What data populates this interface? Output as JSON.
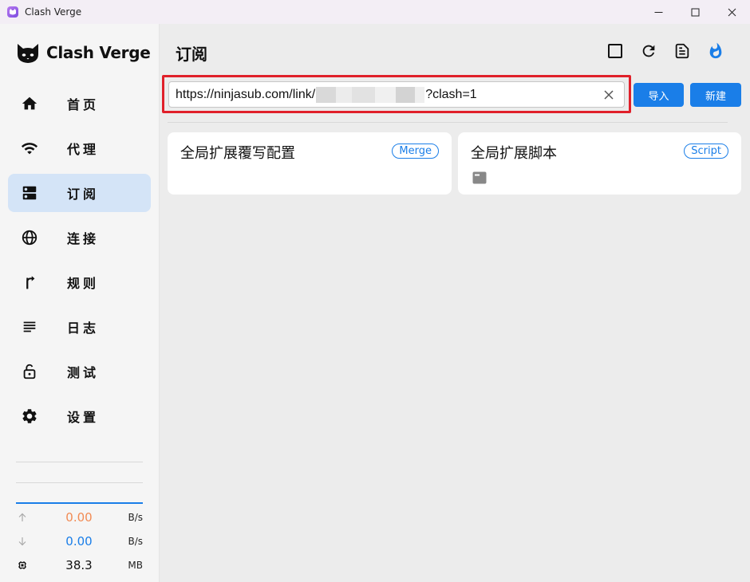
{
  "window": {
    "title": "Clash Verge"
  },
  "sidebar": {
    "logo_text": "Clash Verge",
    "items": [
      {
        "label": "首页",
        "icon": "home-icon",
        "active": false
      },
      {
        "label": "代理",
        "icon": "wifi-icon",
        "active": false
      },
      {
        "label": "订阅",
        "icon": "dns-icon",
        "active": true
      },
      {
        "label": "连接",
        "icon": "globe-icon",
        "active": false
      },
      {
        "label": "规则",
        "icon": "fork-arrow-icon",
        "active": false
      },
      {
        "label": "日志",
        "icon": "lines-icon",
        "active": false
      },
      {
        "label": "测试",
        "icon": "unlock-icon",
        "active": false
      },
      {
        "label": "设置",
        "icon": "gear-icon",
        "active": false
      }
    ],
    "traffic": {
      "upload": {
        "value": "0.00",
        "unit": "B/s",
        "color": "#f28b54"
      },
      "download": {
        "value": "0.00",
        "unit": "B/s",
        "color": "#1a7ee8"
      },
      "memory": {
        "value": "38.3",
        "unit": "MB"
      }
    }
  },
  "main": {
    "title": "订阅",
    "toolbar": [
      "square-icon",
      "refresh-icon",
      "document-icon",
      "flame-icon"
    ],
    "url_input": {
      "prefix": "https://ninjasub.com/link/",
      "suffix": "?clash=1"
    },
    "import_label": "导入",
    "new_label": "新建",
    "cards": [
      {
        "title": "全局扩展覆写配置",
        "badge": "Merge"
      },
      {
        "title": "全局扩展脚本",
        "badge": "Script"
      }
    ]
  },
  "colors": {
    "accent": "#1a7ee8",
    "active_nav": "#d4e4f7",
    "highlight_border": "#e0202a"
  }
}
